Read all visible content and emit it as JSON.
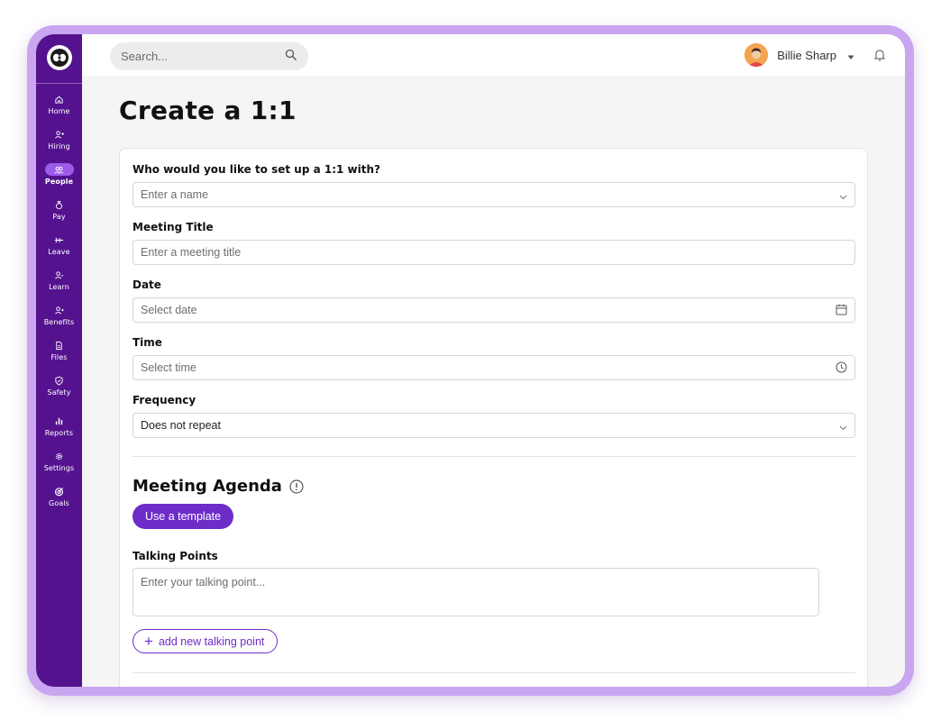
{
  "search": {
    "placeholder": "Search..."
  },
  "user": {
    "name": "Billie Sharp"
  },
  "sidebar": {
    "items": [
      {
        "label": "Home",
        "icon": "home-icon"
      },
      {
        "label": "Hiring",
        "icon": "user-add-icon"
      },
      {
        "label": "People",
        "icon": "people-icon",
        "active": true
      },
      {
        "label": "Pay",
        "icon": "money-bag-icon"
      },
      {
        "label": "Leave",
        "icon": "plane-icon"
      },
      {
        "label": "Learn",
        "icon": "learn-icon"
      },
      {
        "label": "Benefits",
        "icon": "benefits-icon"
      },
      {
        "label": "Files",
        "icon": "file-icon"
      },
      {
        "label": "Safety",
        "icon": "shield-icon"
      },
      {
        "label": "Reports",
        "icon": "bar-chart-icon"
      },
      {
        "label": "Settings",
        "icon": "gear-icon"
      },
      {
        "label": "Goals",
        "icon": "target-icon"
      }
    ]
  },
  "page": {
    "title": "Create a 1:1"
  },
  "form": {
    "who": {
      "label": "Who would you like to set up a 1:1 with?",
      "placeholder": "Enter a name"
    },
    "meeting_title": {
      "label": "Meeting Title",
      "placeholder": "Enter a meeting title"
    },
    "date": {
      "label": "Date",
      "placeholder": "Select date"
    },
    "time": {
      "label": "Time",
      "placeholder": "Select time"
    },
    "frequency": {
      "label": "Frequency",
      "value": "Does not repeat"
    }
  },
  "agenda": {
    "title": "Meeting Agenda",
    "template_button": "Use a template",
    "talking_points_label": "Talking Points",
    "talking_point_placeholder": "Enter your talking point...",
    "add_button": "add new talking point"
  },
  "colors": {
    "sidebar": "#54128f",
    "accent": "#6e2cc9",
    "frame": "#c9a6ef"
  }
}
